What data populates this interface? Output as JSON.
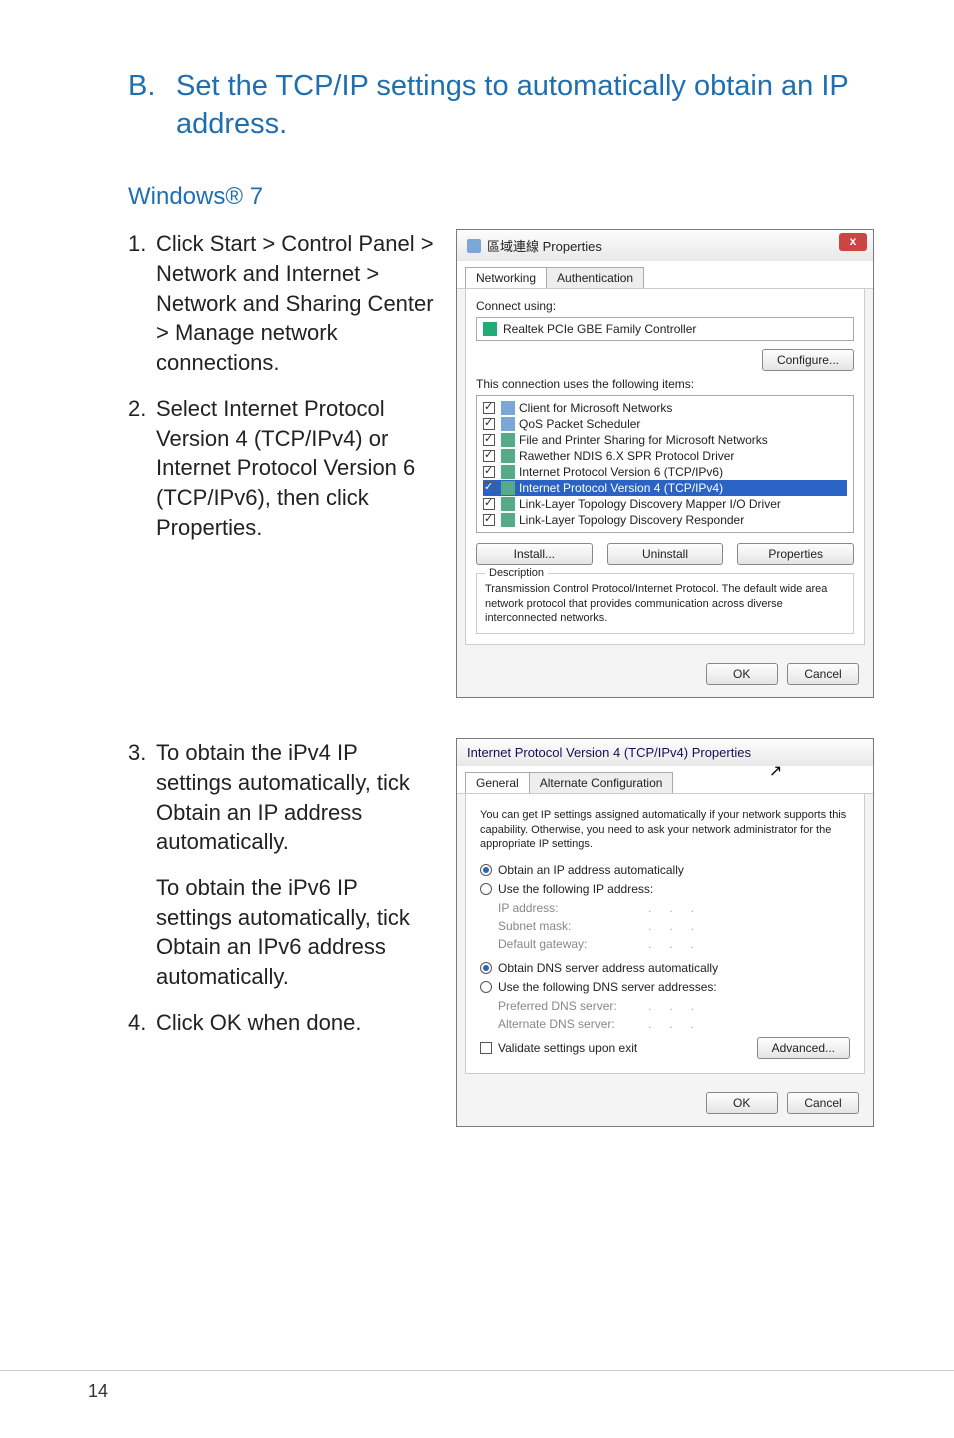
{
  "section": {
    "letter": "B.",
    "title": "Set the TCP/IP settings to automatically obtain an IP address."
  },
  "subheading": "Windows® 7",
  "steps_a": [
    {
      "n": "1.",
      "t": "Click Start > Control Panel > Network and Internet > Network and Sharing Center > Manage network connections."
    },
    {
      "n": "2.",
      "t": "Select Internet Protocol Version 4 (TCP/IPv4) or Internet Protocol Version 6 (TCP/IPv6), then click Properties."
    }
  ],
  "steps_b": [
    {
      "n": "3.",
      "t": "To obtain the iPv4 IP settings automatically, tick Obtain an IP address automatically.",
      "p": "To obtain the iPv6 IP settings automatically, tick Obtain an IPv6 address automatically."
    },
    {
      "n": "4.",
      "t": "Click OK when done."
    }
  ],
  "dlg1": {
    "title": "區域連線 Properties",
    "tabs": [
      "Networking",
      "Authentication"
    ],
    "connect_using_label": "Connect using:",
    "adapter": "Realtek PCIe GBE Family Controller",
    "configure": "Configure...",
    "uses_label": "This connection uses the following items:",
    "items": [
      "Client for Microsoft Networks",
      "QoS Packet Scheduler",
      "File and Printer Sharing for Microsoft Networks",
      "Rawether NDIS 6.X SPR Protocol Driver",
      "Internet Protocol Version 6 (TCP/IPv6)",
      "Internet Protocol Version 4 (TCP/IPv4)",
      "Link-Layer Topology Discovery Mapper I/O Driver",
      "Link-Layer Topology Discovery Responder"
    ],
    "install": "Install...",
    "uninstall": "Uninstall",
    "properties": "Properties",
    "desc_legend": "Description",
    "desc": "Transmission Control Protocol/Internet Protocol. The default wide area network protocol that provides communication across diverse interconnected networks.",
    "ok": "OK",
    "cancel": "Cancel"
  },
  "dlg2": {
    "title": "Internet Protocol Version 4 (TCP/IPv4) Properties",
    "tabs": [
      "General",
      "Alternate Configuration"
    ],
    "info": "You can get IP settings assigned automatically if your network supports this capability. Otherwise, you need to ask your network administrator for the appropriate IP settings.",
    "r_auto_ip": "Obtain an IP address automatically",
    "r_use_ip": "Use the following IP address:",
    "ip_label": "IP address:",
    "mask_label": "Subnet mask:",
    "gw_label": "Default gateway:",
    "r_auto_dns": "Obtain DNS server address automatically",
    "r_use_dns": "Use the following DNS server addresses:",
    "pref_dns": "Preferred DNS server:",
    "alt_dns": "Alternate DNS server:",
    "validate": "Validate settings upon exit",
    "advanced": "Advanced...",
    "ok": "OK",
    "cancel": "Cancel"
  },
  "page_number": "14"
}
